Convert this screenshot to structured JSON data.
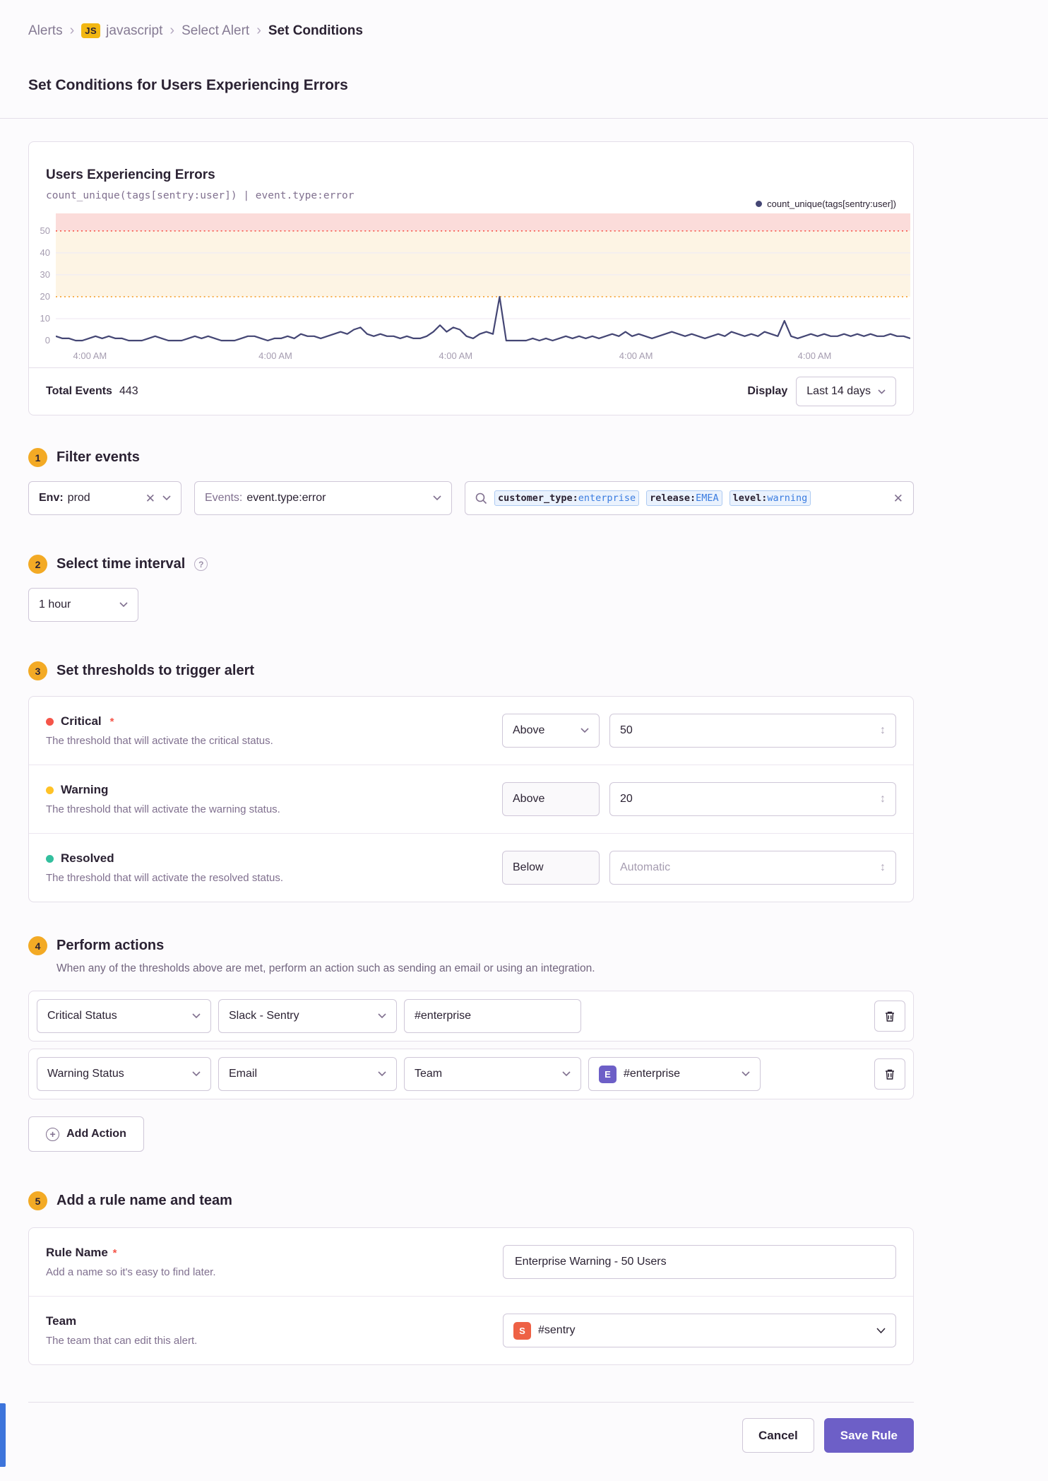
{
  "breadcrumb": {
    "items": [
      "Alerts",
      "javascript",
      "Select Alert",
      "Set Conditions"
    ],
    "project_badge": "JS"
  },
  "page": {
    "title": "Set Conditions for Users Experiencing Errors"
  },
  "chart": {
    "title": "Users Experiencing Errors",
    "query": "count_unique(tags[sentry:user]) | event.type:error",
    "legend_label": "count_unique(tags[sentry:user])",
    "footer": {
      "total_label": "Total Events",
      "total_value": "443",
      "display_label": "Display",
      "display_value": "Last 14 days"
    }
  },
  "chart_data": {
    "type": "line",
    "title": "Users Experiencing Errors",
    "series": [
      {
        "name": "count_unique(tags[sentry:user])",
        "color": "#444674",
        "values": [
          2,
          1,
          1,
          0,
          0,
          1,
          2,
          1,
          2,
          1,
          1,
          0,
          0,
          0,
          1,
          2,
          1,
          0,
          0,
          0,
          1,
          2,
          1,
          2,
          1,
          0,
          0,
          0,
          1,
          2,
          2,
          1,
          0,
          1,
          1,
          2,
          1,
          3,
          2,
          2,
          1,
          2,
          3,
          4,
          3,
          5,
          6,
          3,
          2,
          3,
          2,
          2,
          1,
          2,
          1,
          1,
          2,
          4,
          7,
          4,
          6,
          5,
          2,
          1,
          3,
          4,
          3,
          20,
          0,
          0,
          0,
          0,
          1,
          0,
          1,
          0,
          1,
          2,
          1,
          2,
          1,
          2,
          1,
          2,
          3,
          2,
          4,
          2,
          3,
          2,
          1,
          2,
          3,
          4,
          3,
          2,
          3,
          2,
          1,
          2,
          3,
          2,
          4,
          3,
          2,
          3,
          2,
          4,
          3,
          2,
          9,
          2,
          1,
          2,
          3,
          2,
          3,
          2,
          2,
          3,
          2,
          3,
          2,
          3,
          2,
          2,
          3,
          2,
          2,
          1
        ]
      }
    ],
    "x_tick_labels": [
      "4:00 AM",
      "4:00 AM",
      "4:00 AM",
      "4:00 AM",
      "4:00 AM"
    ],
    "x_tick_fractions": [
      0.04,
      0.257,
      0.468,
      0.679,
      0.888
    ],
    "y_ticks": [
      0,
      10,
      20,
      30,
      40,
      50
    ],
    "y_max": 58,
    "grid_values": [
      10,
      30,
      40
    ],
    "thresholds": {
      "critical": 50,
      "warning": 20
    },
    "band_colors": {
      "critical": "#fbdcda",
      "warning": "#fdf4e4"
    },
    "threshold_line_colors": {
      "critical": "#f55549",
      "warning": "#f5a02d"
    },
    "legend_position": "top-right",
    "ylim": [
      0,
      58
    ]
  },
  "filter": {
    "step": "1",
    "heading": "Filter events",
    "env": {
      "label": "Env:",
      "value": "prod"
    },
    "events": {
      "label": "Events:",
      "value": "event.type:error"
    },
    "search_tokens": [
      {
        "key": "customer_type:",
        "value": "enterprise"
      },
      {
        "key": "release:",
        "value": "EMEA"
      },
      {
        "key": "level:",
        "value": "warning"
      }
    ]
  },
  "interval": {
    "step": "2",
    "heading": "Select time interval",
    "value": "1 hour",
    "help_icon": "?"
  },
  "thresholds": {
    "step": "3",
    "heading": "Set thresholds to trigger alert",
    "rows": [
      {
        "label": "Critical",
        "required": "*",
        "description": "The threshold that will activate the critical status.",
        "comparison": "Above",
        "value": "50",
        "dot_color": "#f55549"
      },
      {
        "label": "Warning",
        "description": "The threshold that will activate the warning status.",
        "comparison": "Above",
        "value": "20",
        "dot_color": "#ffc227"
      },
      {
        "label": "Resolved",
        "description": "The threshold that will activate the resolved status.",
        "comparison": "Below",
        "placeholder": "Automatic",
        "dot_color": "#33bf9e"
      }
    ]
  },
  "actions": {
    "step": "4",
    "heading": "Perform actions",
    "description": "When any of the thresholds above are met, perform an action such as sending an email or using an integration.",
    "row1": {
      "status": "Critical Status",
      "integration": "Slack - Sentry",
      "target": "#enterprise"
    },
    "row2": {
      "status": "Warning Status",
      "integration": "Email",
      "target_type": "Team",
      "team": "#enterprise",
      "team_avatar": "E"
    },
    "add_button": "Add Action"
  },
  "rule": {
    "step": "5",
    "heading": "Add a rule name and team",
    "name": {
      "label": "Rule Name",
      "required": "*",
      "description": "Add a name so it's easy to find later.",
      "value": "Enterprise Warning - 50 Users"
    },
    "team": {
      "label": "Team",
      "description": "The team that can edit this alert.",
      "value": "#sentry",
      "avatar": "S"
    }
  },
  "footer_buttons": {
    "cancel": "Cancel",
    "save": "Save Rule"
  }
}
